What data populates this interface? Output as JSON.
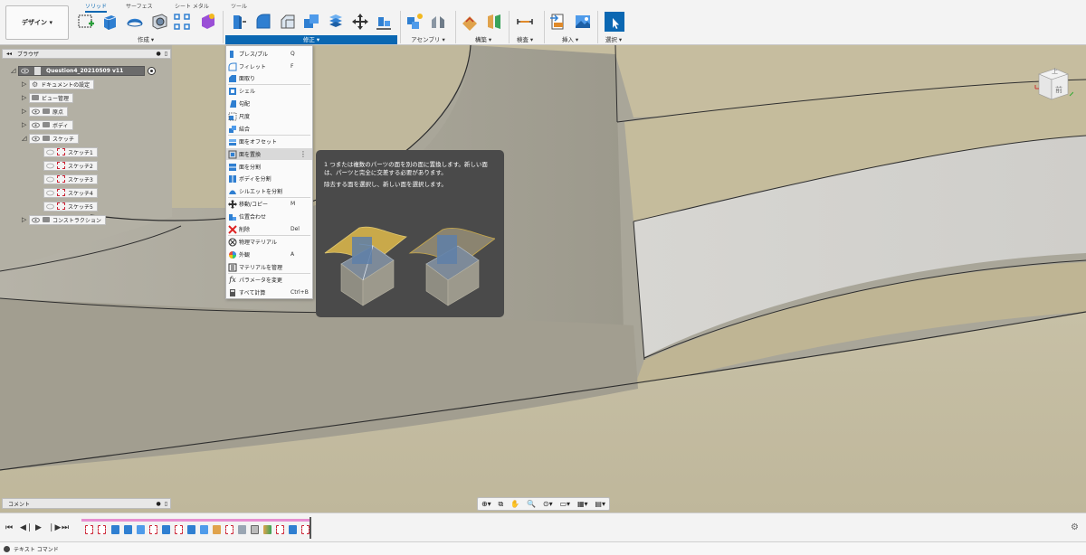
{
  "toolbar": {
    "workspace": "デザイン ▾",
    "tabs": [
      "ソリッド",
      "サーフェス",
      "シート メタル",
      "ツール"
    ],
    "groups": {
      "create": "作成 ▾",
      "modify": "修正 ▾",
      "assemble": "アセンブリ ▾",
      "construct": "構築 ▾",
      "inspect": "検査 ▾",
      "insert": "挿入 ▾",
      "select": "選択 ▾"
    }
  },
  "browser": {
    "title": "ブラウザ",
    "root": "Question4_20210509 v11",
    "items": [
      {
        "label": "ドキュメントの設定"
      },
      {
        "label": "ビュー管理"
      },
      {
        "label": "原点"
      },
      {
        "label": "ボディ"
      },
      {
        "label": "スケッチ"
      },
      {
        "label": "スケッチ1"
      },
      {
        "label": "スケッチ2"
      },
      {
        "label": "スケッチ3"
      },
      {
        "label": "スケッチ4"
      },
      {
        "label": "スケッチ5"
      },
      {
        "label": "コンストラクション"
      }
    ]
  },
  "modify_menu": {
    "items": [
      {
        "label": "プレス/プル",
        "key": "Q"
      },
      {
        "label": "フィレット",
        "key": "F"
      },
      {
        "label": "面取り",
        "key": ""
      },
      {
        "label": "シェル",
        "key": ""
      },
      {
        "label": "勾配",
        "key": ""
      },
      {
        "label": "尺度",
        "key": ""
      },
      {
        "label": "結合",
        "key": ""
      },
      {
        "label": "面をオフセット",
        "key": ""
      },
      {
        "label": "面を置換",
        "key": ""
      },
      {
        "label": "面を分割",
        "key": ""
      },
      {
        "label": "ボディを分割",
        "key": ""
      },
      {
        "label": "シルエットを分割",
        "key": ""
      },
      {
        "label": "移動/コピー",
        "key": "M"
      },
      {
        "label": "位置合わせ",
        "key": ""
      },
      {
        "label": "削除",
        "key": "Del"
      },
      {
        "label": "物理マテリアル",
        "key": ""
      },
      {
        "label": "外観",
        "key": "A"
      },
      {
        "label": "マテリアルを管理",
        "key": ""
      },
      {
        "label": "パラメータを変更",
        "key": ""
      },
      {
        "label": "すべて計算",
        "key": "Ctrl+B"
      }
    ]
  },
  "tooltip": {
    "line1": "1 つまたは複数のパーツの面を別の面に置換します。新しい面は、パーツと完全に交差する必要があります。",
    "line2": "除去する面を選択し、新しい面を選択します。"
  },
  "comments": {
    "label": "コメント"
  },
  "statusbar": {
    "label": "テキスト コマンド"
  },
  "viewcube": {
    "top": "上",
    "front": "前"
  },
  "colors": {
    "accent": "#0a67b2",
    "tooltip_bg": "#4a4a4a",
    "timeline_bar": "#e78fd0"
  }
}
